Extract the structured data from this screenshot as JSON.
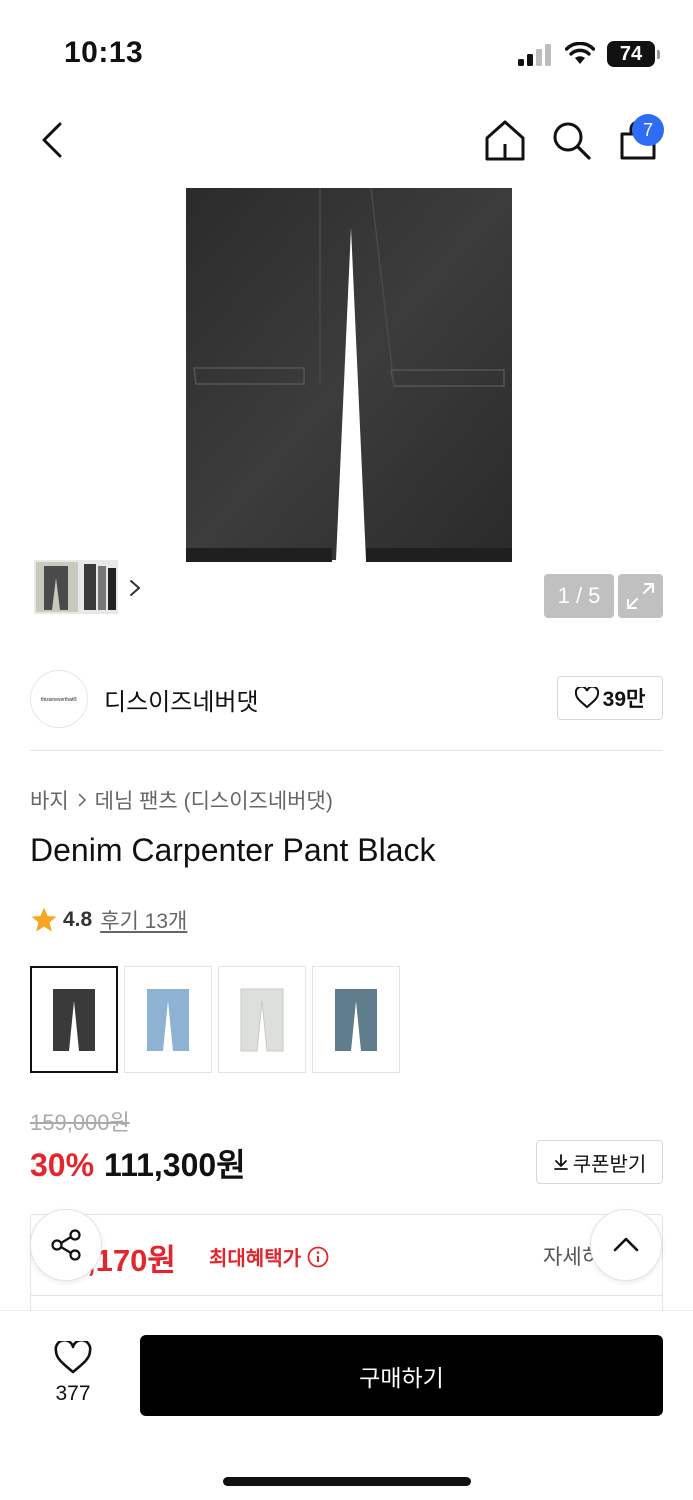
{
  "status_bar": {
    "time": "10:13",
    "battery": "74"
  },
  "nav": {
    "cart_badge": "7"
  },
  "gallery": {
    "counter": "1 / 5"
  },
  "brand": {
    "logo_text": "thisisneverthat®",
    "name": "디스이즈네버댓",
    "likes": "39만"
  },
  "product": {
    "breadcrumb": [
      "바지",
      "데님 팬츠 (디스이즈네버댓)"
    ],
    "title": "Denim Carpenter Pant Black",
    "rating": "4.8",
    "reviews": "후기 13개",
    "swatches": [
      {
        "name": "black",
        "color": "#3a3a3a"
      },
      {
        "name": "light-blue",
        "color": "#8eb2d3"
      },
      {
        "name": "ecru",
        "color": "#dde0da"
      },
      {
        "name": "dark-blue",
        "color": "#5f7d8c"
      }
    ]
  },
  "price": {
    "original": "159,000원",
    "discount": "30%",
    "sale": "111,300원",
    "coupon_label": "쿠폰받기"
  },
  "benefit": {
    "price": ",170원",
    "label": "최대혜택가",
    "detail": "자세히"
  },
  "bottom": {
    "wish_count": "377",
    "buy_label": "구매하기"
  },
  "colors": {
    "accent_red": "#e3262d",
    "badge_blue": "#2f6cf5"
  }
}
